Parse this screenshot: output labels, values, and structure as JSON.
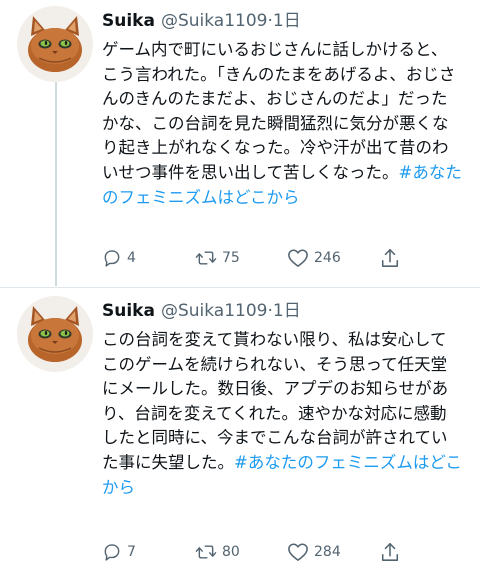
{
  "tweets": [
    {
      "user": {
        "display_name": "Suika",
        "handle": "@Suika1109",
        "separator": "·",
        "time": "1日"
      },
      "text": "ゲーム内で町にいるおじさんに話しかけると、こう言われた。「きんのたまをあげるよ、おじさんのきんのたまだよ、おじさんのだよ」だったかな、この台詞を見た瞬間猛烈に気分が悪くなり起き上がれなくなった。冷や汗が出て昔のわいせつ事件を思い出して苦しくなった。",
      "hashtag": "#あなたのフェミニズムはどこから",
      "stats": {
        "replies": "4",
        "retweets": "75",
        "likes": "246"
      }
    },
    {
      "user": {
        "display_name": "Suika",
        "handle": "@Suika1109",
        "separator": "·",
        "time": "1日"
      },
      "text": "この台詞を変えて貰わない限り、私は安心してこのゲームを続けられない、そう思って任天堂にメールした。数日後、アプデのお知らせがあり、台詞を変えてくれた。速やかな対応に感動したと同時に、今までこんな台詞が許されていた事に失望した。",
      "hashtag": "#あなたのフェミニズムはどこから",
      "stats": {
        "replies": "7",
        "retweets": "80",
        "likes": "284"
      }
    }
  ],
  "colors": {
    "text": "#0f1419",
    "secondary": "#536471",
    "hashtag": "#1d9bf0",
    "divider": "#e1e8ed"
  },
  "icons": [
    "reply-icon",
    "retweet-icon",
    "like-icon",
    "share-icon"
  ]
}
